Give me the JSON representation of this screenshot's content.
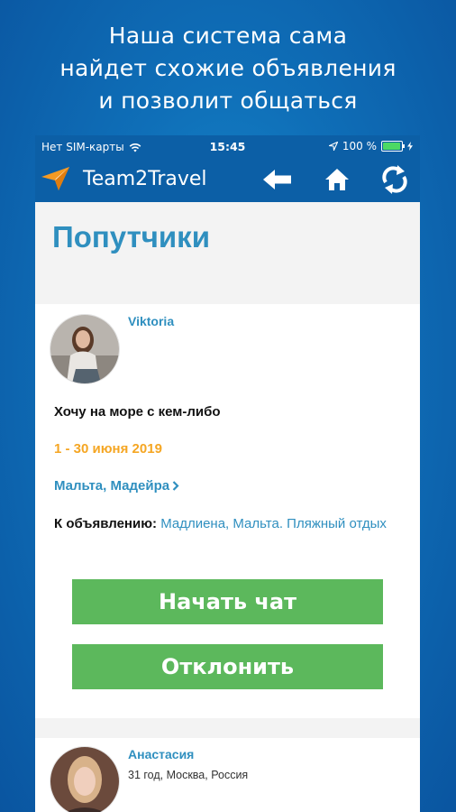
{
  "promo": {
    "lines": [
      "Наша система сама",
      "найдет схожие объявления",
      "и позволит общаться"
    ]
  },
  "status_bar": {
    "carrier": "Нет SIM-карты",
    "time": "15:45",
    "battery": "100 %",
    "icons": [
      "wifi-icon",
      "location-arrow-icon",
      "battery-icon",
      "charging-icon"
    ]
  },
  "navbar": {
    "app_title": "Team2Travel",
    "logo_icon": "paper-plane-icon",
    "buttons": [
      "back-arrow-icon",
      "home-icon",
      "refresh-icon"
    ]
  },
  "page": {
    "title": "Попутчики"
  },
  "cards": [
    {
      "name": "Viktoria",
      "ad_title": "Хочу на море с кем-либо",
      "dates": "1 - 30 июня 2019",
      "places": "Мальта, Мадейра",
      "link_label": "К объявлению:",
      "link_text": "Мадлиена, Мальта. Пляжный отдых",
      "start_chat": "Начать чат",
      "decline": "Отклонить"
    },
    {
      "name": "Анастасия",
      "meta": "31 год, Москва, Россия"
    }
  ],
  "colors": {
    "brand_blue": "#0c5fa6",
    "title_blue": "#2f8fbf",
    "dates_orange": "#f5a623",
    "button_green": "#5cb85c"
  }
}
